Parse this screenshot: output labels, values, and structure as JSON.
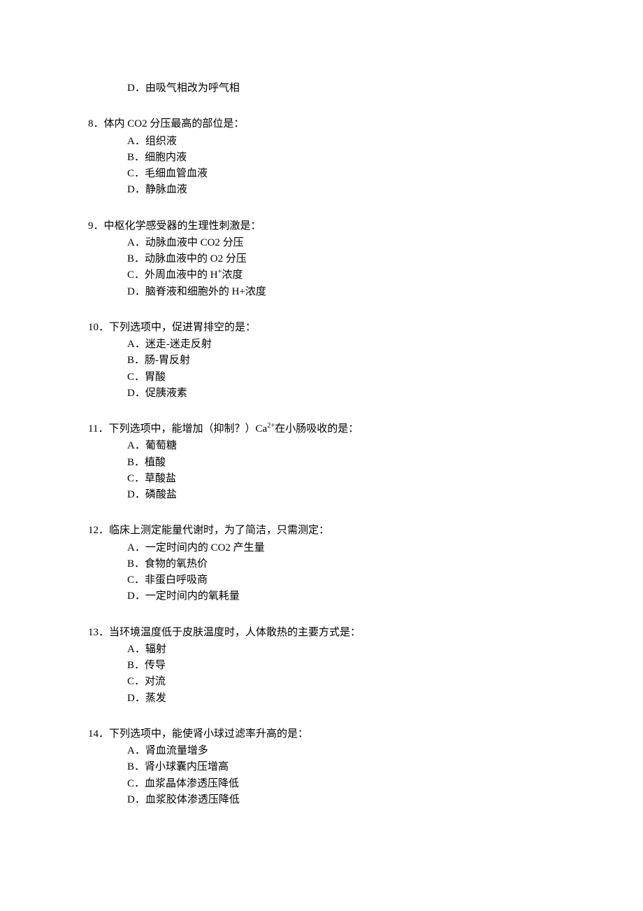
{
  "orphan": {
    "label": "D．",
    "text": "由吸气相改为呼气相"
  },
  "questions": [
    {
      "num": "8．",
      "stem": "体内 CO2 分压最高的部位是：",
      "options": [
        {
          "label": "A．",
          "text": "组织液"
        },
        {
          "label": "B．",
          "text": "细胞内液"
        },
        {
          "label": "C．",
          "text": "毛细血管血液"
        },
        {
          "label": "D．",
          "text": "静脉血液"
        }
      ]
    },
    {
      "num": "9．",
      "stem": "中枢化学感受器的生理性刺激是：",
      "options": [
        {
          "label": "A．",
          "text": "动脉血液中 CO2 分压"
        },
        {
          "label": "B．",
          "text": "动脉血液中的 O2 分压"
        },
        {
          "label": "C．",
          "text_html": "外周血液中的 H<span class='sup'>+</span>浓度"
        },
        {
          "label": "D．",
          "text": "脑脊液和细胞外的 H+浓度"
        }
      ]
    },
    {
      "num": "10．",
      "stem": "下列选项中，促进胃排空的是：",
      "options": [
        {
          "label": "A．",
          "text": "迷走-迷走反射"
        },
        {
          "label": "B．",
          "text": "肠-胃反射"
        },
        {
          "label": "C．",
          "text": "胃酸"
        },
        {
          "label": "D．",
          "text": "促胰液素"
        }
      ]
    },
    {
      "num": "11．",
      "stem_html": "下列选项中，能增加（抑制？）Ca<span class='sup'>2+</span>在小肠吸收的是：",
      "options": [
        {
          "label": "A．",
          "text": "葡萄糖"
        },
        {
          "label": "B．",
          "text": "植酸"
        },
        {
          "label": "C．",
          "text": "草酸盐"
        },
        {
          "label": "D．",
          "text": "磷酸盐"
        }
      ]
    },
    {
      "num": "12．",
      "stem": "临床上测定能量代谢时，为了简洁，只需测定：",
      "options": [
        {
          "label": "A．",
          "text": "一定时间内的 CO2 产生量"
        },
        {
          "label": "B．",
          "text": "食物的氧热价"
        },
        {
          "label": "C．",
          "text": "非蛋白呼吸商"
        },
        {
          "label": "D．",
          "text": "一定时间内的氧耗量"
        }
      ]
    },
    {
      "num": "13．",
      "stem": "当环境温度低于皮肤温度时，人体散热的主要方式是：",
      "options": [
        {
          "label": "A．",
          "text": "辐射"
        },
        {
          "label": "B．",
          "text": "传导"
        },
        {
          "label": "C．",
          "text": "对流"
        },
        {
          "label": "D．",
          "text": "蒸发"
        }
      ]
    },
    {
      "num": "14．",
      "stem": "下列选项中，能使肾小球过滤率升高的是：",
      "options": [
        {
          "label": "A．",
          "text": "肾血流量增多"
        },
        {
          "label": "B．",
          "text": "肾小球囊内压增高"
        },
        {
          "label": "C．",
          "text": "血浆晶体渗透压降低"
        },
        {
          "label": "D．",
          "text": "血浆胶体渗透压降低"
        }
      ]
    }
  ]
}
